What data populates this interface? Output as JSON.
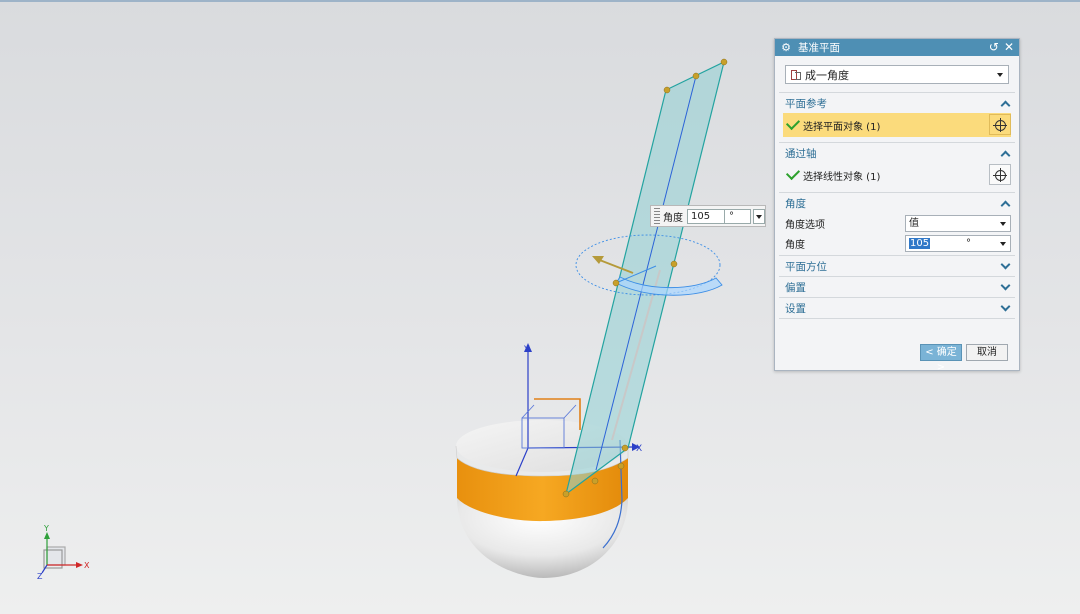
{
  "viewport": {
    "background_top": "#d9dbde",
    "background_bottom": "#eeefef",
    "axis_labels": {
      "y": "Y",
      "x": "X",
      "z": "Z"
    }
  },
  "angle_popup": {
    "label": "角度",
    "value": "105",
    "unit": "°"
  },
  "dialog": {
    "title": "基准平面",
    "title_icons": [
      "reset-icon",
      "close-icon"
    ],
    "type_selector": {
      "value": "成一角度",
      "icon": "angle-plane-icon"
    },
    "sections": {
      "plane_ref": {
        "label": "平面参考",
        "expanded": true,
        "select_text": "选择平面对象 (1)",
        "active": true
      },
      "through_axis": {
        "label": "通过轴",
        "expanded": true,
        "select_text": "选择线性对象 (1)"
      },
      "angle": {
        "label": "角度",
        "expanded": true,
        "option_label": "角度选项",
        "option_value": "值",
        "angle_label": "角度",
        "angle_value": "105",
        "angle_unit": "°"
      },
      "plane_orient": {
        "label": "平面方位",
        "expanded": false
      },
      "offset": {
        "label": "偏置",
        "expanded": false
      },
      "settings": {
        "label": "设置",
        "expanded": false
      }
    },
    "ok_label": "< 确定 >",
    "cancel_label": "取消"
  },
  "colors": {
    "titlebar": "#4e8fb4",
    "section_header": "#2e6f96",
    "active_row": "#fbdb7c",
    "plane_fill": "#8fd0d4",
    "plane_edge": "#23a3a0",
    "band_orange": "#f29f1b",
    "handle": "#c8a02a"
  }
}
